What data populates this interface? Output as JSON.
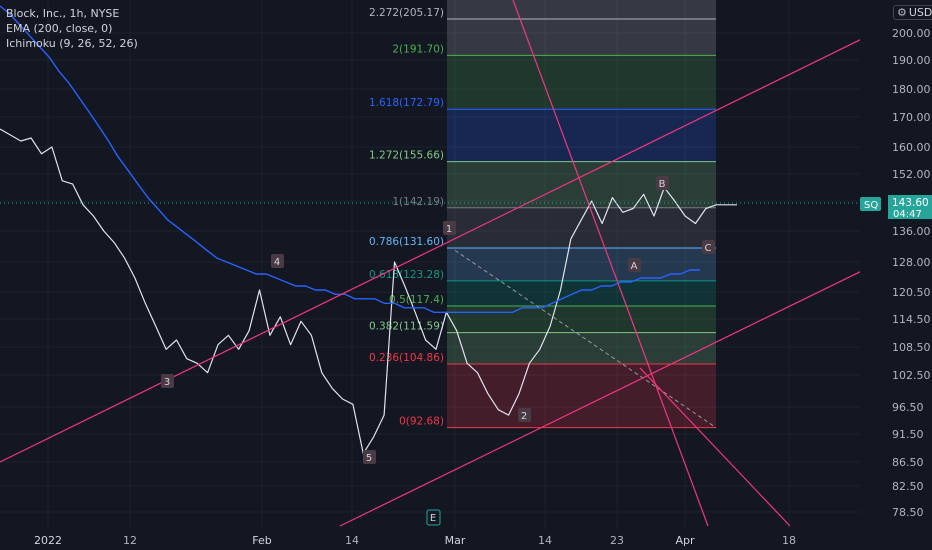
{
  "legend": {
    "symbol_line": "Block, Inc., 1h, NYSE",
    "ema_line": "EMA (200, close, 0)",
    "ichimoku_line": "Ichimoku (9, 26, 52, 26)"
  },
  "currency_label": "USD",
  "last_price": {
    "symbol": "SQ",
    "price": "143.60",
    "countdown": "04:47"
  },
  "chart_data": {
    "type": "line",
    "ylim": [
      74,
      228
    ],
    "y_ticks": [
      "78.50",
      "82.50",
      "86.50",
      "91.50",
      "96.50",
      "102.50",
      "108.50",
      "114.50",
      "120.50",
      "128.00",
      "136.00",
      "144.00",
      "152.00",
      "160.00",
      "170.00",
      "180.00",
      "190.00",
      "200.00"
    ],
    "x_ticks": [
      "2022",
      "12",
      "Feb",
      "14",
      "Mar",
      "14",
      "23",
      "Apr",
      "18"
    ],
    "fib_levels": [
      {
        "label": "0(92.68)",
        "value": 92.68,
        "color": "#f23645"
      },
      {
        "label": "0.236(104.86)",
        "value": 104.86,
        "color": "#f23645"
      },
      {
        "label": "0.382(111.59)",
        "value": 111.59,
        "color": "#81c784"
      },
      {
        "label": "0.5(117.4)",
        "value": 117.4,
        "color": "#4caf50"
      },
      {
        "label": "0.618(123.28)",
        "value": 123.28,
        "color": "#089981"
      },
      {
        "label": "0.786(131.60)",
        "value": 131.6,
        "color": "#64b5f6"
      },
      {
        "label": "1(142.19)",
        "value": 142.19,
        "color": "#787b86"
      },
      {
        "label": "1.272(155.66)",
        "value": 155.66,
        "color": "#81c784"
      },
      {
        "label": "1.618(172.79)",
        "value": 172.79,
        "color": "#2962ff"
      },
      {
        "label": "2(191.70)",
        "value": 191.7,
        "color": "#4caf50"
      },
      {
        "label": "2.272(205.17)",
        "value": 205.17,
        "color": "#b2b5be"
      }
    ],
    "wave_labels": [
      "1",
      "2",
      "3",
      "4",
      "5",
      "A",
      "B",
      "C",
      "E"
    ],
    "series": [
      {
        "values": [
          166,
          164,
          162,
          163,
          158,
          160,
          150,
          149,
          143,
          140,
          136,
          133,
          129,
          124,
          118,
          113,
          108,
          110,
          106,
          105,
          103,
          109,
          111,
          108,
          112,
          121,
          111,
          115,
          109,
          114,
          111,
          103,
          100,
          98,
          97,
          88,
          91,
          95,
          128,
          122,
          116,
          110,
          108,
          116,
          112,
          105,
          103,
          99,
          96,
          95,
          99,
          105,
          108,
          113,
          121,
          134,
          139,
          144,
          138,
          145,
          141,
          142,
          146,
          140,
          148,
          144,
          140,
          138,
          142,
          143,
          143,
          143
        ]
      },
      {
        "values": [
          210,
          207,
          203,
          199,
          195,
          191,
          186,
          182,
          177,
          172,
          167,
          162,
          157,
          153,
          149,
          145,
          142,
          139,
          137,
          135,
          133,
          131,
          129,
          128,
          127,
          126,
          125,
          125,
          124,
          123,
          122,
          122,
          121,
          121,
          120,
          120,
          119,
          119,
          119,
          118,
          118,
          117,
          117,
          117,
          116,
          116,
          116,
          116,
          116,
          116,
          116,
          116,
          116,
          117,
          117,
          117,
          118,
          119,
          120,
          121,
          121,
          122,
          122,
          123,
          123,
          124,
          124,
          124,
          125,
          125,
          126,
          126
        ]
      }
    ]
  }
}
